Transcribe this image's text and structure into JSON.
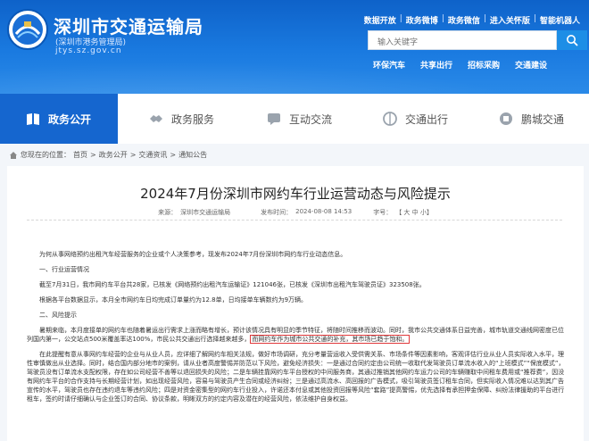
{
  "header": {
    "site_title": "深圳市交通运输局",
    "site_subtitle": "(深圳市港务管理局)",
    "site_domain": "jtys.sz.gov.cn",
    "top_links": [
      "数据开放",
      "政务微博",
      "政务微信",
      "进入关怀版",
      "智能机器人"
    ],
    "search_placeholder": "输入关键字",
    "quick_links": [
      "环保汽车",
      "共享出行",
      "招标采购",
      "交通建设"
    ]
  },
  "nav": {
    "items": [
      {
        "label": "政务公开",
        "icon": "book-icon",
        "active": true
      },
      {
        "label": "政务服务",
        "icon": "handshake-icon",
        "active": false
      },
      {
        "label": "互动交流",
        "icon": "chat-icon",
        "active": false
      },
      {
        "label": "交通出行",
        "icon": "road-icon",
        "active": false
      },
      {
        "label": "鹏城交通",
        "icon": "building-icon",
        "active": false
      }
    ]
  },
  "breadcrumb": {
    "prefix": "您现在的位置：",
    "items": [
      "首页",
      "政务公开",
      "交通资讯",
      "通知公告"
    ]
  },
  "article": {
    "title": "2024年7月份深圳市网约车行业运营动态与风险提示",
    "source_label": "来源：",
    "source": "深圳市交通运输局",
    "date_label": "发布时间：",
    "date": "2024-08-08 14:53",
    "size_label": "字号：",
    "size_options": "【 大 中 小】",
    "paragraphs": {
      "intro": "为何从事网络预约出租汽车经营服务的企业或个人决策参考，现发布2024年7月份深圳市网约车行业动态信息。",
      "sec1": "一、行业运营情况",
      "p1": "截至7月31日，我市网约车平台共28家，已核发《网络预约出租汽车运输证》121046张，已核发《深圳市出租汽车驾驶员证》323508张。",
      "p2": "根据各平台数据显示，本月全市网约车日均完成订单量约为12.8单，日均接单车辆数约为9万辆。",
      "sec2": "二、风险提示",
      "p3a": "暑期来临，本月度接单的网约车也随着暑运出行需求上涨而略有增长，预计该情况具有明显的季节特征，将随时间推移而波动。同时，我市公共交通体系日益完善，城市轨道交通线网密度已位列国内第一，公交站点500米覆盖率达100%，市民公共交通出行选择越来越多，",
      "p3b": "而网约车作为城市公共交通的补充，其市场已趋于饱和。",
      "p4": "在此提醒有意从事网约车经营的企业与从业人员，应详细了解网约车相关法规，做好市场调研，充分考量营运收入受供需关系、市场条件等因素影响，客观评估行业从业人员实际收入水平，理性审慎做出从业选择。同时，结合国内部分地市的案例，请从业者高度警惕并防范以下风险，避免经济损失：一是通过合同约定由公司统一收取代发驾驶员订单流水收入的“上班模式”“保底模式”，驾驶员没有订单流水支配权限，存在如公司经营不善等以退回损失的风险；二是车辆挂靠网约车平台授权的中间服务商，其通过推销其他网约车运力公司的车辆赚取中间租车费用或“推荐费”，因没有网约车平台的合作支持与长期经营计划，如出现经营风险，容易与驾驶员产生合同或经济纠纷；三是通过高流水、高回报的广告模式，吸引驾驶员签订租车合同，但实际收入情况难以达到其广告宣传的水平，驾驶员也存在违约退车等违约风险；四是对资金密集型的网约车行业投入，许诺还本付息或其他投资回报等风险“套路”提高警惕，优先选择有承担押金保障、纠纷法律援助的平台进行租车，签约时请仔细确认与企业签订的合同、协议条款，明晰双方的约定内容及潜在的经营风险，依法维护自身权益。"
    }
  }
}
